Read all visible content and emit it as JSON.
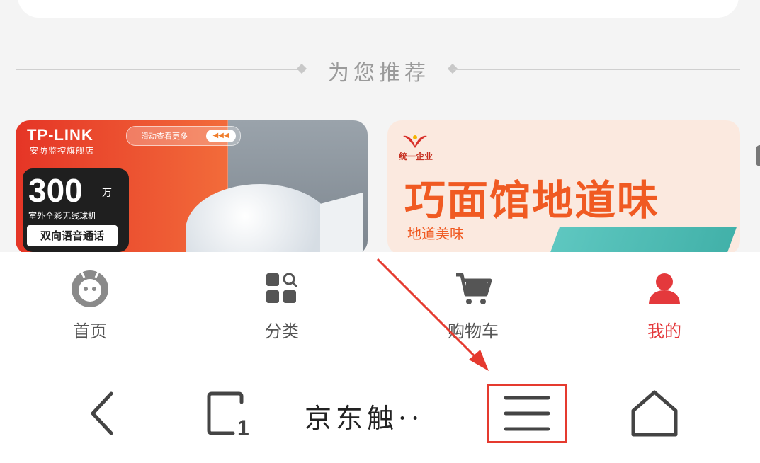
{
  "recommend": {
    "title": "为您推荐"
  },
  "products": [
    {
      "brand": "TP-LINK",
      "brand_sub": "安防监控旗舰店",
      "pill_text": "滑动查看更多",
      "pill_btn": "◀◀◀",
      "big_number": "300",
      "unit": "万",
      "desc": "室外全彩无线球机",
      "tag": "双向语音通话"
    },
    {
      "logo_text": "统一企业",
      "title": "巧面馆地道味",
      "subtitle": "地道美味"
    }
  ],
  "tabbar": {
    "items": [
      {
        "label": "首页",
        "icon": "jd-mascot-icon"
      },
      {
        "label": "分类",
        "icon": "category-icon"
      },
      {
        "label": "购物车",
        "icon": "cart-icon"
      },
      {
        "label": "我的",
        "icon": "user-icon",
        "active": true
      }
    ],
    "active_color": "#e4393c"
  },
  "browser": {
    "page_title": "京东触··",
    "buttons": [
      "back-icon",
      "tabs-icon",
      "menu-icon",
      "home-icon"
    ],
    "tab_count": "1"
  },
  "annotation": {
    "highlight_color": "#e53a2f"
  }
}
